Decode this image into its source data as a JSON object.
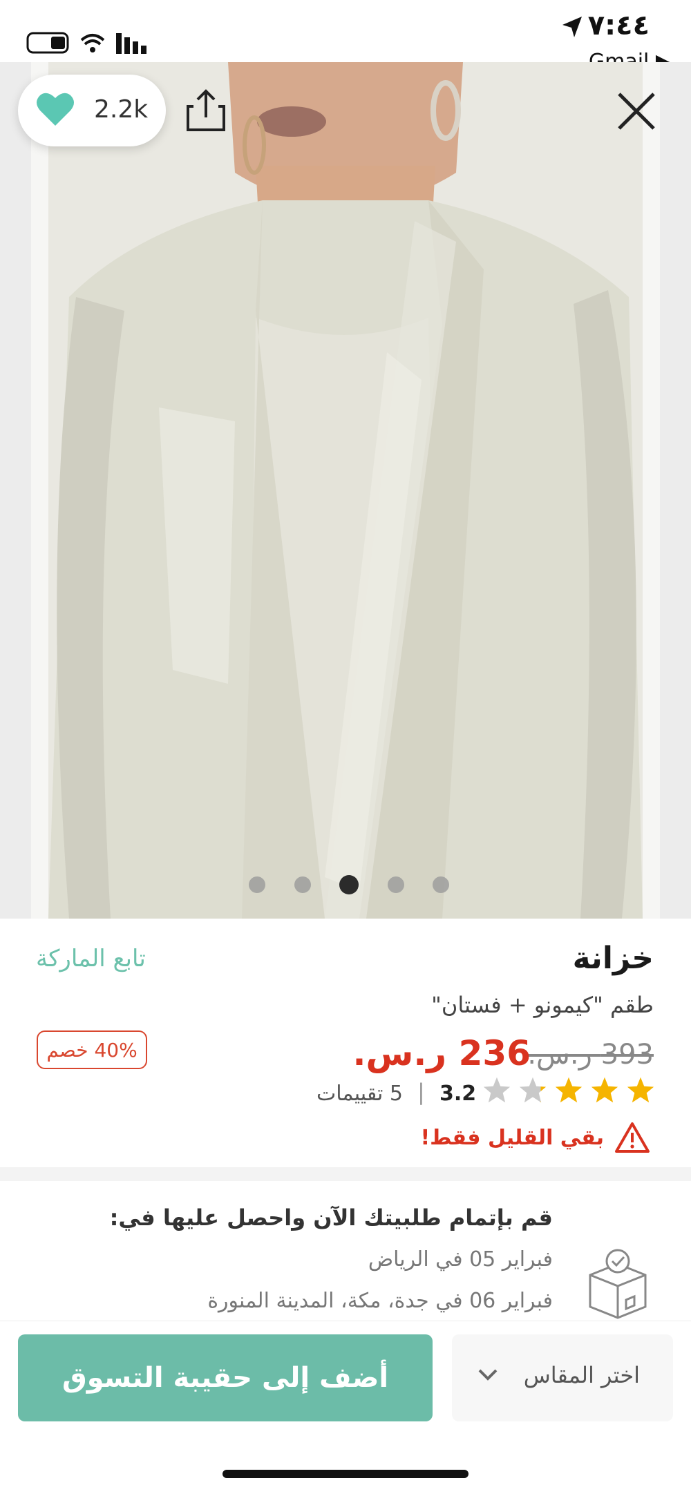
{
  "status_bar": {
    "time": "٧:٤٤",
    "back_app": "Gmail ▶"
  },
  "hero": {
    "likes": "2.2k",
    "image_count": 5,
    "active_index": 3
  },
  "product": {
    "brand": "خزانة",
    "follow_label": "تابع الماركة",
    "name": "طقم \"كيمونو + فستان\"",
    "discount": "40% خصم",
    "old_price": "393 ر.س.",
    "new_price": "236 ر.س.",
    "rating": {
      "value": "3.2",
      "separator": "|",
      "reviews": "5 تقييمات",
      "stars_out_of": 5,
      "score": 3.2
    },
    "stock_warning": "بقي القليل فقط!"
  },
  "delivery": {
    "title": "قم بإتمام طلبيتك الآن واحصل عليها في:",
    "line1": "فبراير 05 في الرياض",
    "line2": "فبراير 06 في جدة، مكة، المدينة المنورة"
  },
  "actions": {
    "size_placeholder": "اختر المقاس",
    "add_to_bag": "أضف إلى حقيبة التسوق"
  },
  "colors": {
    "accent": "#6cbca8",
    "price_red": "#d9321f",
    "heart": "#5bc7b3"
  }
}
